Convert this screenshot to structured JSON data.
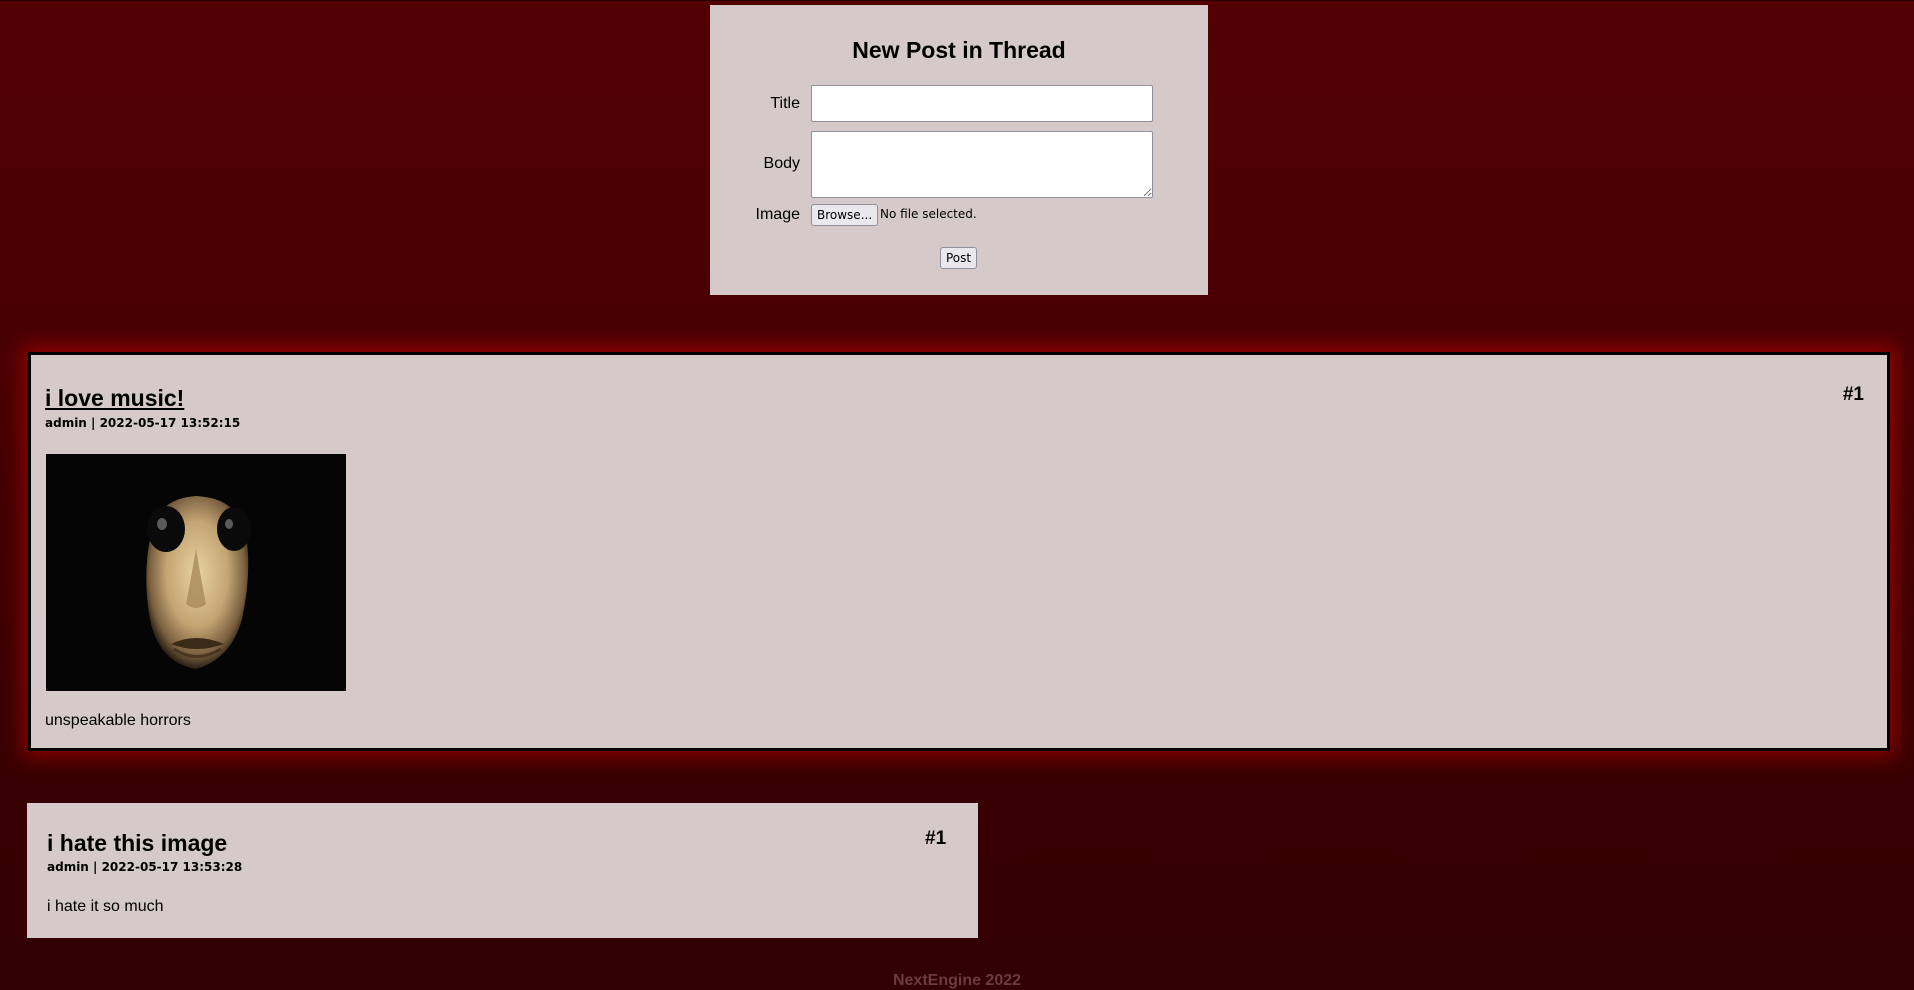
{
  "form": {
    "heading": "New Post in Thread",
    "title_label": "Title",
    "body_label": "Body",
    "image_label": "Image",
    "browse_label": "Browse...",
    "file_status": "No file selected.",
    "post_label": "Post",
    "title_value": "",
    "body_value": ""
  },
  "posts": [
    {
      "title": "i love music!",
      "meta": "admin | 2022-05-17 13:52:15",
      "number": "#1",
      "body": "unspeakable horrors",
      "has_image": true
    },
    {
      "title": "i hate this image",
      "meta": "admin | 2022-05-17 13:53:28",
      "number": "#1",
      "body": "i hate it so much",
      "has_image": false
    }
  ],
  "footer": {
    "text": "NextEngine 2022"
  },
  "colors": {
    "background": "#470002",
    "panel": "#d5c9c9",
    "glow": "#c80000",
    "footer_text": "#6b3b3d"
  }
}
